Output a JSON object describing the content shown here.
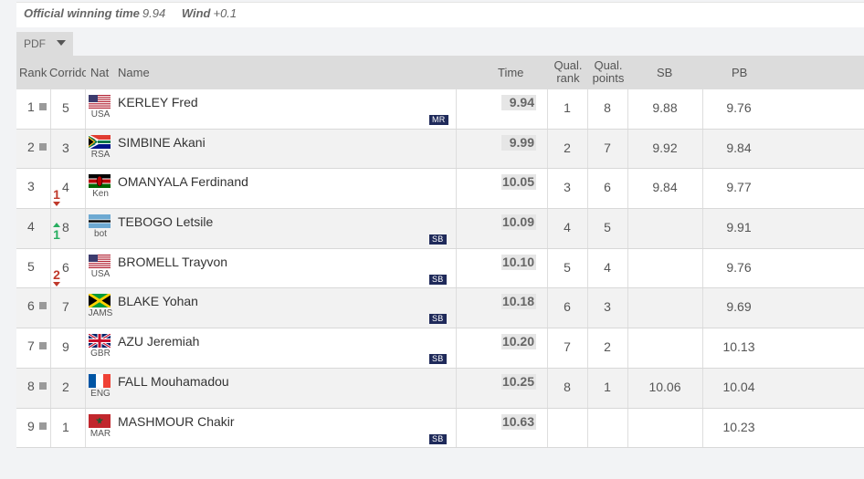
{
  "header": {
    "official_label": "Official winning time",
    "official_value": "9.94",
    "wind_label": "Wind",
    "wind_value": "+0.1"
  },
  "pdf_button": {
    "label": "PDF",
    "icon": "caret-down-icon"
  },
  "columns": {
    "rank": "Rank",
    "corridor": "Corrido",
    "nat": "Nat",
    "name": "Name",
    "time": "Time",
    "qual_rank_1": "Qual.",
    "qual_rank_2": "rank",
    "qual_points_1": "Qual.",
    "qual_points_2": "points",
    "sb": "SB",
    "pb": "PB"
  },
  "rows": [
    {
      "rank": "1",
      "move": "",
      "move_dir": "none",
      "corridor": "5",
      "nat": "USA",
      "flag": "usa",
      "name": "KERLEY Fred",
      "badge": "MR",
      "time": "9.94",
      "qual_rank": "1",
      "qual_points": "8",
      "sb": "9.88",
      "pb": "9.76"
    },
    {
      "rank": "2",
      "move": "",
      "move_dir": "none",
      "corridor": "3",
      "nat": "RSA",
      "flag": "rsa",
      "name": "SIMBINE Akani",
      "badge": "",
      "time": "9.99",
      "qual_rank": "2",
      "qual_points": "7",
      "sb": "9.92",
      "pb": "9.84"
    },
    {
      "rank": "3",
      "move": "1",
      "move_dir": "down",
      "corridor": "4",
      "nat": "Ken",
      "flag": "ken",
      "name": "OMANYALA Ferdinand",
      "badge": "",
      "time": "10.05",
      "qual_rank": "3",
      "qual_points": "6",
      "sb": "9.84",
      "pb": "9.77"
    },
    {
      "rank": "4",
      "move": "1",
      "move_dir": "up",
      "corridor": "8",
      "nat": "bot",
      "flag": "bot",
      "name": "TEBOGO Letsile",
      "badge": "SB",
      "time": "10.09",
      "qual_rank": "4",
      "qual_points": "5",
      "sb": "",
      "pb": "9.91"
    },
    {
      "rank": "5",
      "move": "2",
      "move_dir": "down",
      "corridor": "6",
      "nat": "USA",
      "flag": "usa",
      "name": "BROMELL Trayvon",
      "badge": "SB",
      "time": "10.10",
      "qual_rank": "5",
      "qual_points": "4",
      "sb": "",
      "pb": "9.76"
    },
    {
      "rank": "6",
      "move": "",
      "move_dir": "none",
      "corridor": "7",
      "nat": "JAMS",
      "flag": "jam",
      "name": "BLAKE Yohan",
      "badge": "SB",
      "time": "10.18",
      "qual_rank": "6",
      "qual_points": "3",
      "sb": "",
      "pb": "9.69"
    },
    {
      "rank": "7",
      "move": "",
      "move_dir": "none",
      "corridor": "9",
      "nat": "GBR",
      "flag": "gbr",
      "name": "AZU Jeremiah",
      "badge": "SB",
      "time": "10.20",
      "qual_rank": "7",
      "qual_points": "2",
      "sb": "",
      "pb": "10.13"
    },
    {
      "rank": "8",
      "move": "",
      "move_dir": "none",
      "corridor": "2",
      "nat": "ENG",
      "flag": "fra",
      "name": "FALL Mouhamadou",
      "badge": "",
      "time": "10.25",
      "qual_rank": "8",
      "qual_points": "1",
      "sb": "10.06",
      "pb": "10.04"
    },
    {
      "rank": "9",
      "move": "",
      "move_dir": "none",
      "corridor": "1",
      "nat": "MAR",
      "flag": "mar",
      "name": "MASHMOUR Chakir",
      "badge": "SB",
      "time": "10.63",
      "qual_rank": "",
      "qual_points": "",
      "sb": "",
      "pb": "10.23"
    }
  ]
}
